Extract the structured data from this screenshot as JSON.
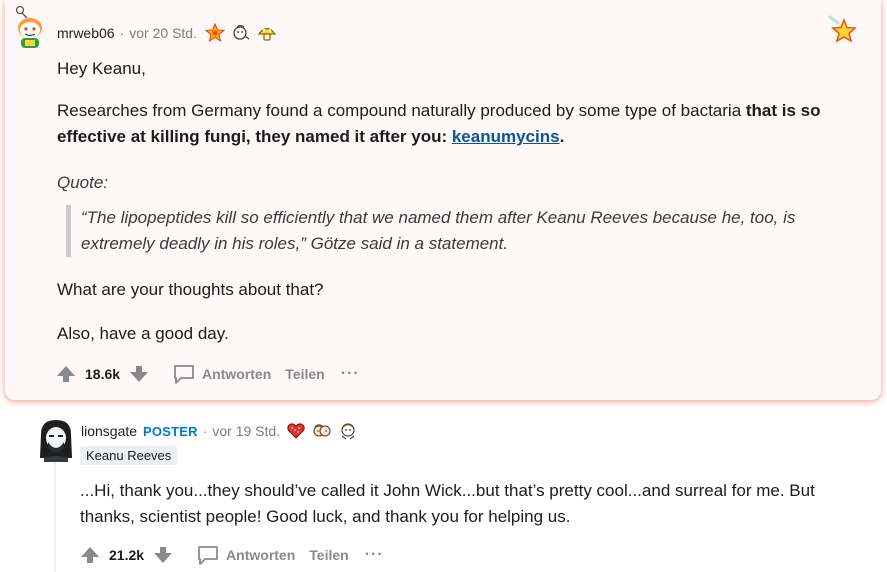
{
  "comment1": {
    "username": "mrweb06",
    "separator": "·",
    "time": "vor 20 Std.",
    "awards": [
      "wholesome-star-award-icon",
      "helpful-award-icon",
      "gold-mushroom-award-icon"
    ],
    "greeting": "Hey Keanu,",
    "para_start": "Researches from Germany found a compound naturally produced by some type of bactaria ",
    "para_bold": "that is so effective at killing fungi, they named it after you: ",
    "para_link": "keanumycins",
    "para_end": ".",
    "quote_label": "Quote:",
    "quote_text": "“The lipopeptides kill so efficiently that we named them after Keanu Reeves because he, too, is extremely deadly in his roles,” Götze said in a statement.",
    "para_thoughts": "What are your thoughts about that?",
    "para_bye": "Also, have a good day.",
    "score": "18.6k",
    "reply_label": "Antworten",
    "share_label": "Teilen",
    "more_label": "···"
  },
  "comment2": {
    "username": "lionsgate",
    "poster_badge": "POSTER",
    "separator": "·",
    "time": "vor 19 Std.",
    "awards": [
      "heart-award-icon",
      "hug-award-icon",
      "bravo-award-icon"
    ],
    "flair": "Keanu Reeves",
    "body": "...Hi, thank you...they should’ve called it John Wick...but that’s pretty cool...and surreal for me. But thanks, scientist people! Good luck, and thank you for helping us.",
    "score": "21.2k",
    "reply_label": "Antworten",
    "share_label": "Teilen",
    "more_label": "···"
  },
  "colors": {
    "highlight_bg": "#fff8f8",
    "highlight_glow": "#ff8c8c",
    "link": "#0a5499",
    "poster": "#0079d3",
    "muted": "#878a8c"
  }
}
